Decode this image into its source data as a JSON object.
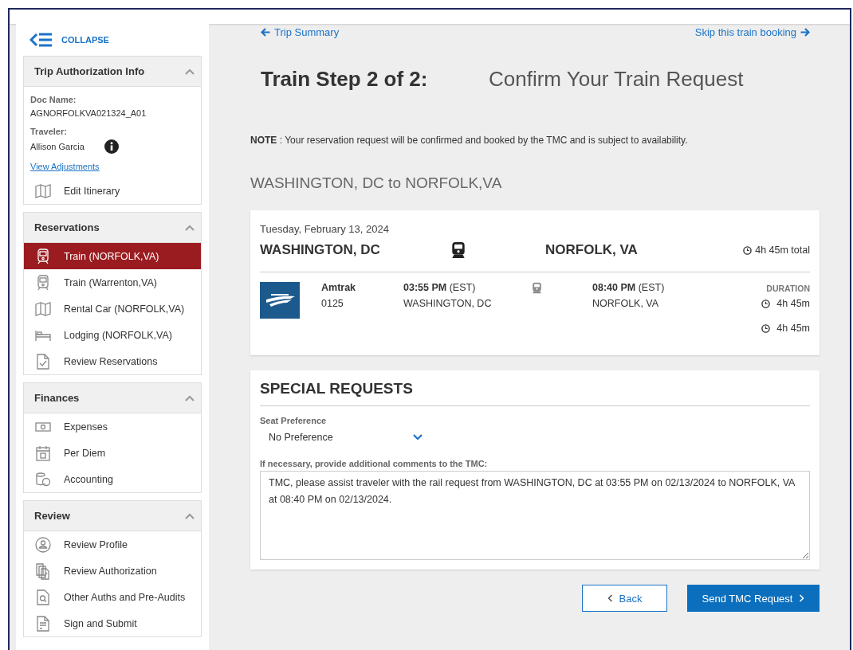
{
  "sidebar": {
    "collapse_label": "COLLAPSE",
    "sections": [
      {
        "title": "Trip Authorization Info",
        "expanded": true,
        "fields": [
          {
            "label": "Doc Name:",
            "value": "AGNORFOLKVA021324_A01",
            "info": false
          },
          {
            "label": "Traveler:",
            "value": "Allison Garcia",
            "info": true
          }
        ],
        "link": "View Adjustments",
        "items": [
          {
            "label": "Edit Itinerary",
            "kind": "map",
            "selected": false
          }
        ]
      },
      {
        "title": "Reservations",
        "expanded": true,
        "items": [
          {
            "label": "Train (NORFOLK,VA)",
            "kind": "train",
            "selected": true
          },
          {
            "label": "Train (Warrenton,VA)",
            "kind": "train",
            "selected": false
          },
          {
            "label": "Rental Car (NORFOLK,VA)",
            "kind": "map",
            "selected": false
          },
          {
            "label": "Lodging (NORFOLK,VA)",
            "kind": "bed",
            "selected": false
          },
          {
            "label": "Review Reservations",
            "kind": "doc-check",
            "selected": false
          }
        ]
      },
      {
        "title": "Finances",
        "expanded": true,
        "items": [
          {
            "label": "Expenses",
            "kind": "money",
            "selected": false
          },
          {
            "label": "Per Diem",
            "kind": "calendar",
            "selected": false
          },
          {
            "label": "Accounting",
            "kind": "coins",
            "selected": false
          }
        ]
      },
      {
        "title": "Review",
        "expanded": true,
        "items": [
          {
            "label": "Review Profile",
            "kind": "profile",
            "selected": false
          },
          {
            "label": "Review Authorization",
            "kind": "docs",
            "selected": false
          },
          {
            "label": "Other Auths and Pre-Audits",
            "kind": "search-doc",
            "selected": false
          },
          {
            "label": "Sign and Submit",
            "kind": "sign-doc",
            "selected": false
          }
        ]
      }
    ]
  },
  "main": {
    "back_link": "Trip Summary",
    "skip_link": "Skip this train booking",
    "step_title": "Train Step 2 of 2:",
    "step_subtitle": "Confirm Your Train Request",
    "note": "**NOTE** : Your reservation request will be confirmed and booked by the TMC and is subject to availability.",
    "route": "WASHINGTON, DC to NORFOLK,VA",
    "trip": {
      "date": "Tuesday, February 13, 2024",
      "origin": "WASHINGTON, DC",
      "destination": "NORFOLK, VA",
      "total": "4h 45m total",
      "segment": {
        "carrier": "Amtrak",
        "number": "0125",
        "depart_time": "03:55 PM",
        "depart_zone": "(EST)",
        "depart_city": "WASHINGTON, DC",
        "arrive_time": "08:40 PM",
        "arrive_zone": "(EST)",
        "arrive_city": "NORFOLK, VA",
        "duration_label": "DURATION",
        "durations": [
          "4h 45m",
          "4h 45m"
        ]
      }
    },
    "special": {
      "title": "SPECIAL REQUESTS",
      "seat_label": "Seat Preference",
      "seat_value": "No Preference",
      "comments_label": "If necessary, provide additional comments to the TMC:",
      "comments": "TMC, please assist traveler with the rail request from WASHINGTON, DC at 03:55 PM on 02/13/2024 to NORFOLK, VA at 08:40 PM on 02/13/2024."
    },
    "buttons": {
      "back": "Back",
      "send": "Send TMC Request"
    }
  }
}
